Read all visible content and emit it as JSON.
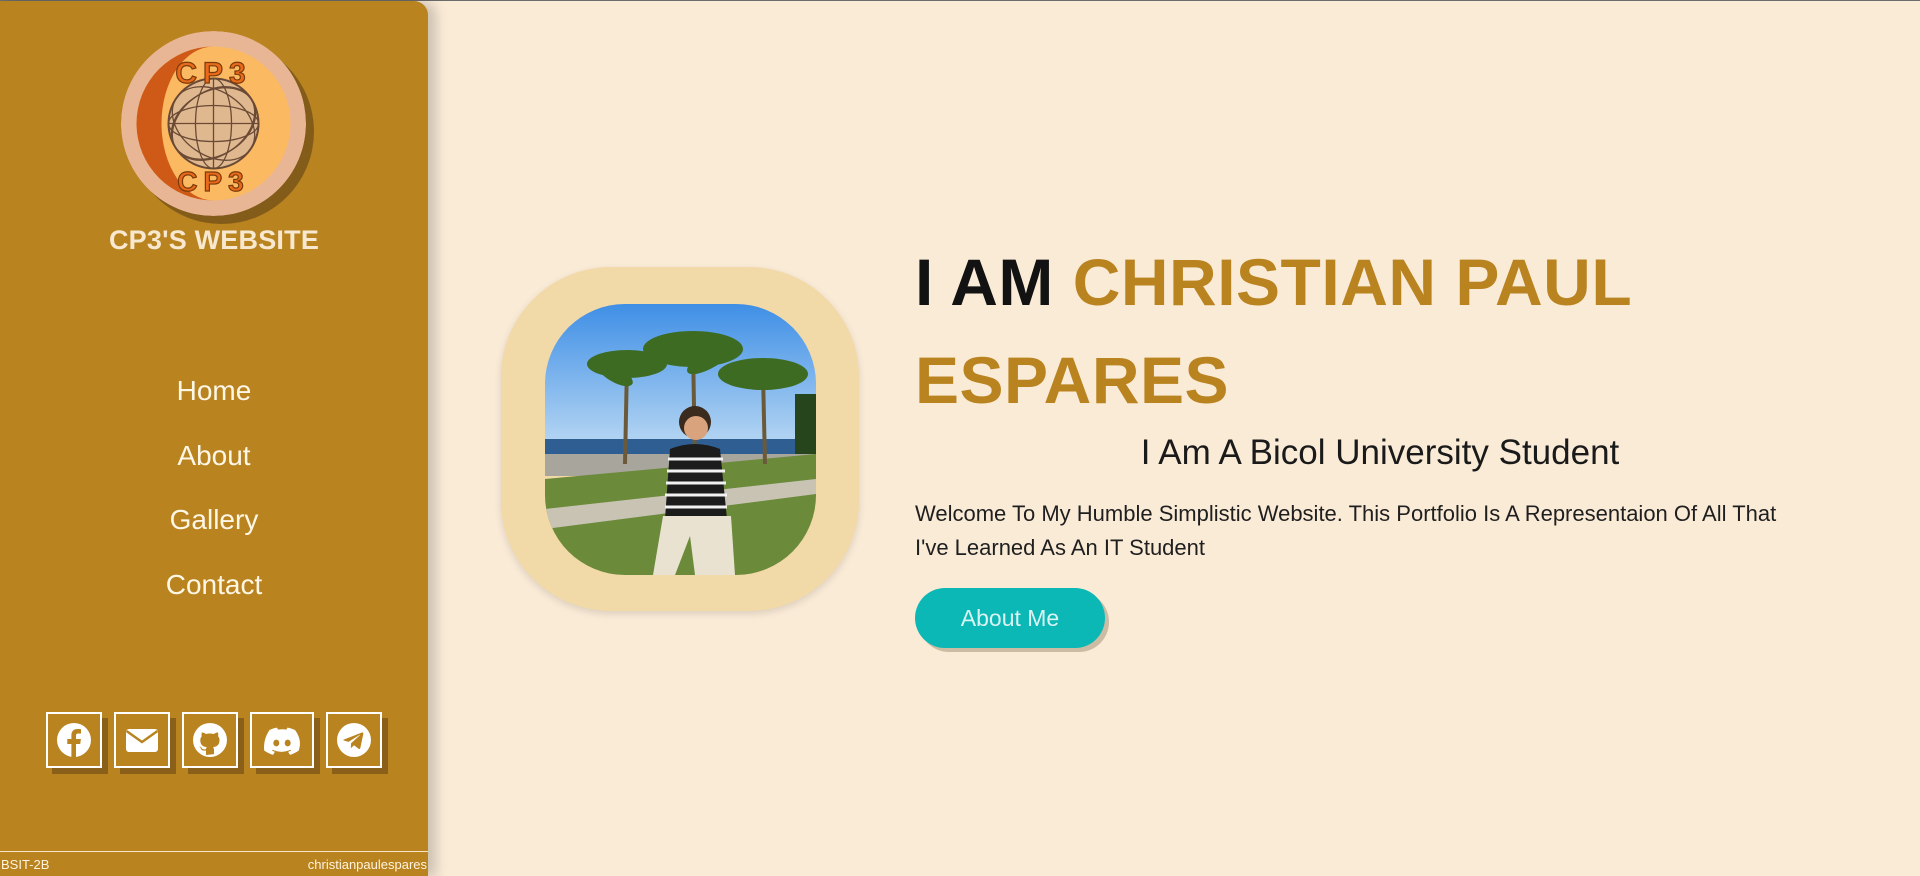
{
  "sidebar": {
    "logo_text_top": "CP3",
    "logo_text_bottom": "CP3",
    "site_title": "CP3'S WEBSITE",
    "nav": [
      {
        "label": "Home"
      },
      {
        "label": "About"
      },
      {
        "label": "Gallery"
      },
      {
        "label": "Contact"
      }
    ],
    "socials": [
      {
        "icon": "facebook-icon"
      },
      {
        "icon": "email-icon"
      },
      {
        "icon": "github-icon"
      },
      {
        "icon": "discord-icon"
      },
      {
        "icon": "telegram-icon"
      }
    ],
    "footer_left": "BSIT-2B",
    "footer_right": "christianpaulespares"
  },
  "hero": {
    "headline_prefix": "I AM ",
    "headline_name": "CHRISTIAN PAUL ESPARES",
    "subtitle": "I Am A Bicol University Student",
    "intro": "Welcome To My Humble Simplistic Website. This Portfolio Is A Representaion Of All That I've Learned As An IT Student",
    "button_label": "About Me"
  },
  "colors": {
    "sidebar_bg": "#b98320",
    "page_bg": "#faebd7",
    "accent": "#b98320",
    "button": "#0bb8b6",
    "photo_frame": "#f2d9a8"
  }
}
